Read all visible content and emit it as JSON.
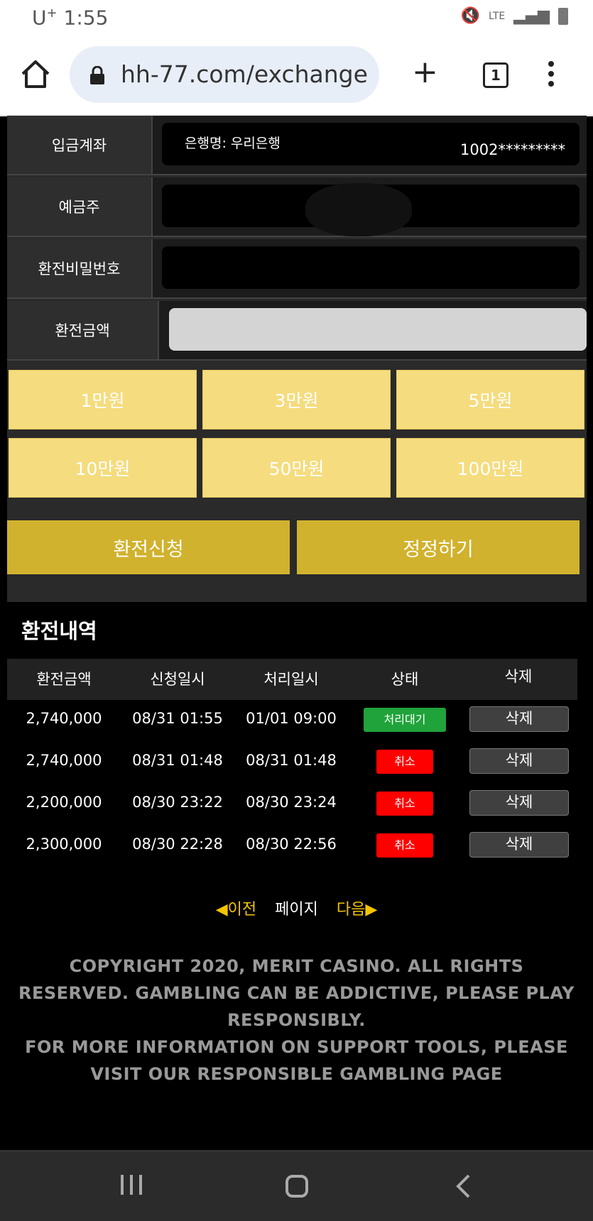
{
  "status_bar": {
    "carrier": "U",
    "carrier_sup": "+",
    "time": "1:55",
    "network": "LTE"
  },
  "browser": {
    "url": "hh-77.com/exchange",
    "tab_count": "1"
  },
  "form": {
    "deposit_account_label": "입금계좌",
    "bank_name": "은행명: 우리은행",
    "account_number": "1002*********",
    "depositor_label": "예금주",
    "password_label": "환전비밀번호",
    "amount_label": "환전금액"
  },
  "amount_buttons": [
    "1만원",
    "3만원",
    "5만원",
    "10만원",
    "50만원",
    "100만원"
  ],
  "actions": {
    "apply": "환전신청",
    "reset": "정정하기"
  },
  "history": {
    "title": "환전내역",
    "columns": [
      "환전금액",
      "신청일시",
      "처리일시",
      "상태",
      "삭제"
    ],
    "rows": [
      {
        "amount": "2,740,000",
        "requested": "08/31 01:55",
        "processed": "01/01 09:00",
        "status": "처리대기",
        "status_color": "#1fa33a",
        "delete": "삭제"
      },
      {
        "amount": "2,740,000",
        "requested": "08/31 01:48",
        "processed": "08/31 01:48",
        "status": "취소",
        "status_color": "#ff0000",
        "delete": "삭제"
      },
      {
        "amount": "2,200,000",
        "requested": "08/30 23:22",
        "processed": "08/30 23:24",
        "status": "취소",
        "status_color": "#ff0000",
        "delete": "삭제"
      },
      {
        "amount": "2,300,000",
        "requested": "08/30 22:28",
        "processed": "08/30 22:56",
        "status": "취소",
        "status_color": "#ff0000",
        "delete": "삭제"
      }
    ]
  },
  "pagination": {
    "prev": "◀이전",
    "page": "페이지",
    "next": "다음▶"
  },
  "footer": {
    "line1": "COPYRIGHT 2020, MERIT CASINO. ALL RIGHTS RESERVED. GAMBLING CAN BE ADDICTIVE, PLEASE PLAY RESPONSIBLY.",
    "line2": "FOR MORE INFORMATION ON SUPPORT TOOLS, PLEASE VISIT OUR RESPONSIBLE GAMBLING PAGE"
  }
}
